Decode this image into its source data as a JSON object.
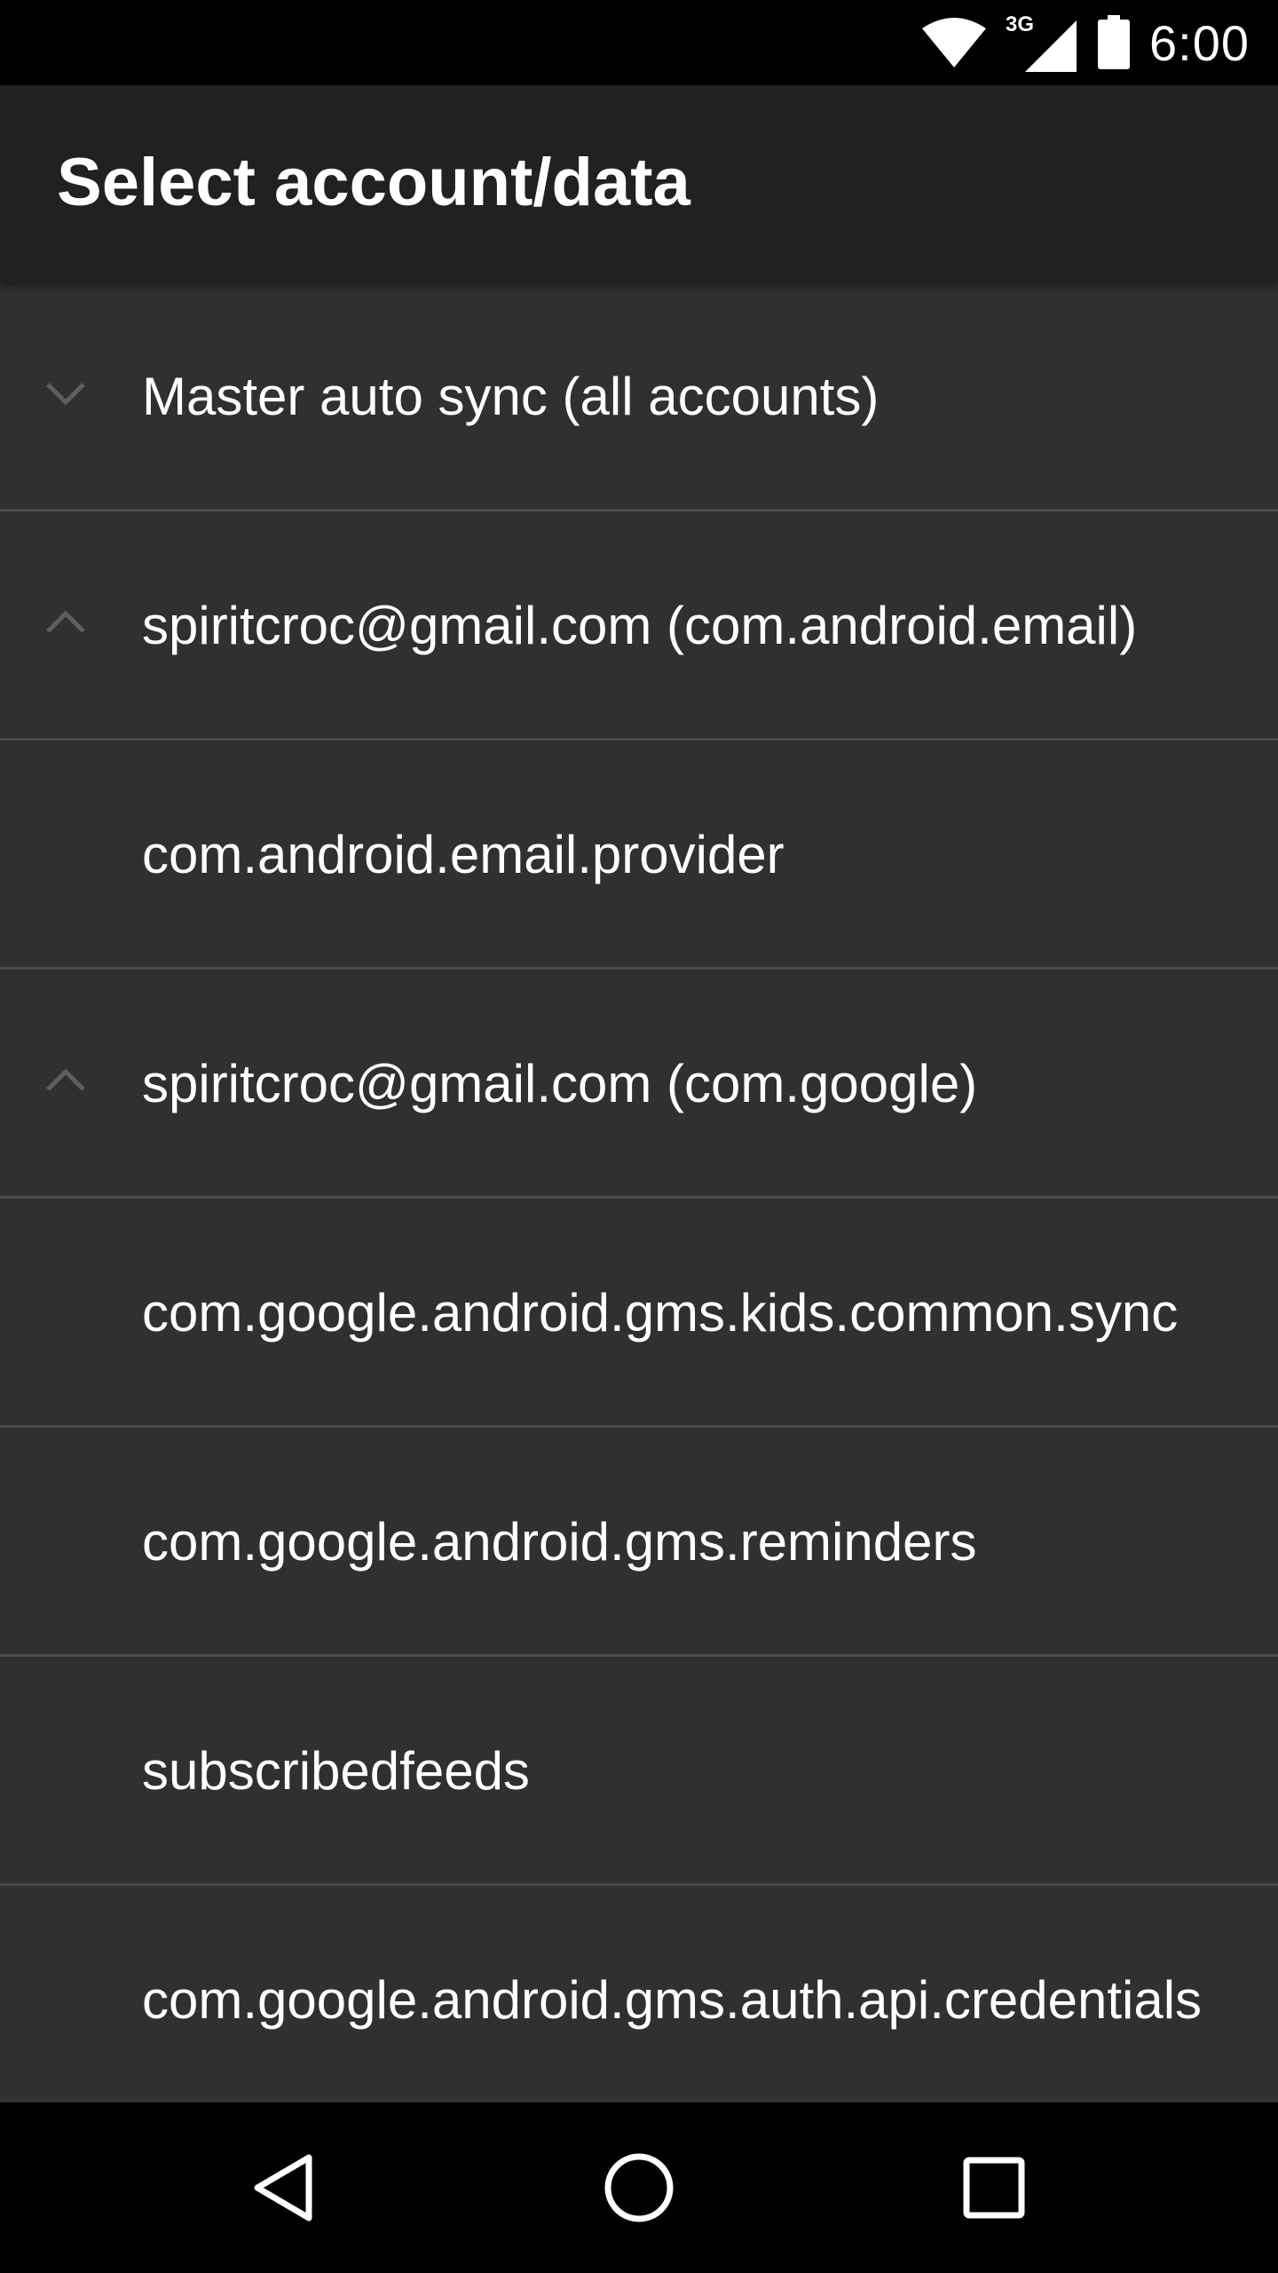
{
  "status_bar": {
    "time": "6:00",
    "network_label": "3G",
    "icons": [
      "wifi-icon",
      "cellular-signal-icon",
      "battery-icon"
    ]
  },
  "app_bar": {
    "title": "Select account/data"
  },
  "list": {
    "items": [
      {
        "label": "Master auto sync (all accounts)",
        "icon": "chevron-down-icon"
      },
      {
        "label": "spiritcroc@gmail.com (com.android.email)",
        "icon": "chevron-up-icon"
      },
      {
        "label": "com.android.email.provider"
      },
      {
        "label": "spiritcroc@gmail.com (com.google)",
        "icon": "chevron-up-icon"
      },
      {
        "label": "com.google.android.gms.kids.common.sync"
      },
      {
        "label": "com.google.android.gms.reminders"
      },
      {
        "label": "subscribedfeeds"
      },
      {
        "label": "com.google.android.gms.auth.api.credentials"
      }
    ]
  },
  "nav_bar": {
    "buttons": [
      "back-icon",
      "home-icon",
      "recents-icon"
    ]
  },
  "colors": {
    "status_bar_bg": "#000000",
    "app_bar_bg": "#212121",
    "list_bg": "#303030",
    "divider": "#4a4a4a",
    "text": "#ffffff",
    "chevron": "#5e5e5e"
  }
}
